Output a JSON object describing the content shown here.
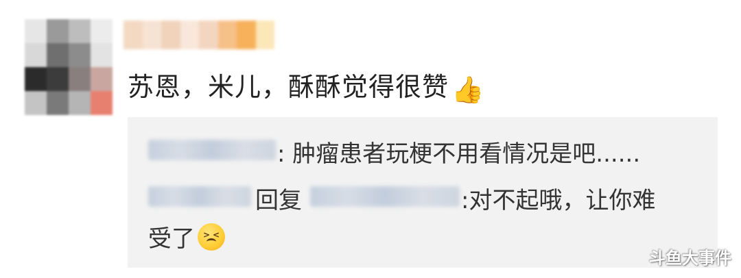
{
  "comment": {
    "text": "苏恩，米儿，酥酥觉得很赞",
    "emoji": "👍"
  },
  "replies": [
    {
      "separator": ":",
      "text": "肿瘤患者玩梗不用看情况是吧......"
    },
    {
      "reply_word": "回复",
      "separator": ":",
      "text_line1": "对不起哦，让你难",
      "text_line2": "受了",
      "emoji_icon": "tired-face-icon"
    }
  ],
  "watermark": "斗鱼大事件",
  "colors": {
    "reply_background": "#f2f2f2",
    "text": "#222222",
    "mosaic_blue": "#c8d2de"
  }
}
